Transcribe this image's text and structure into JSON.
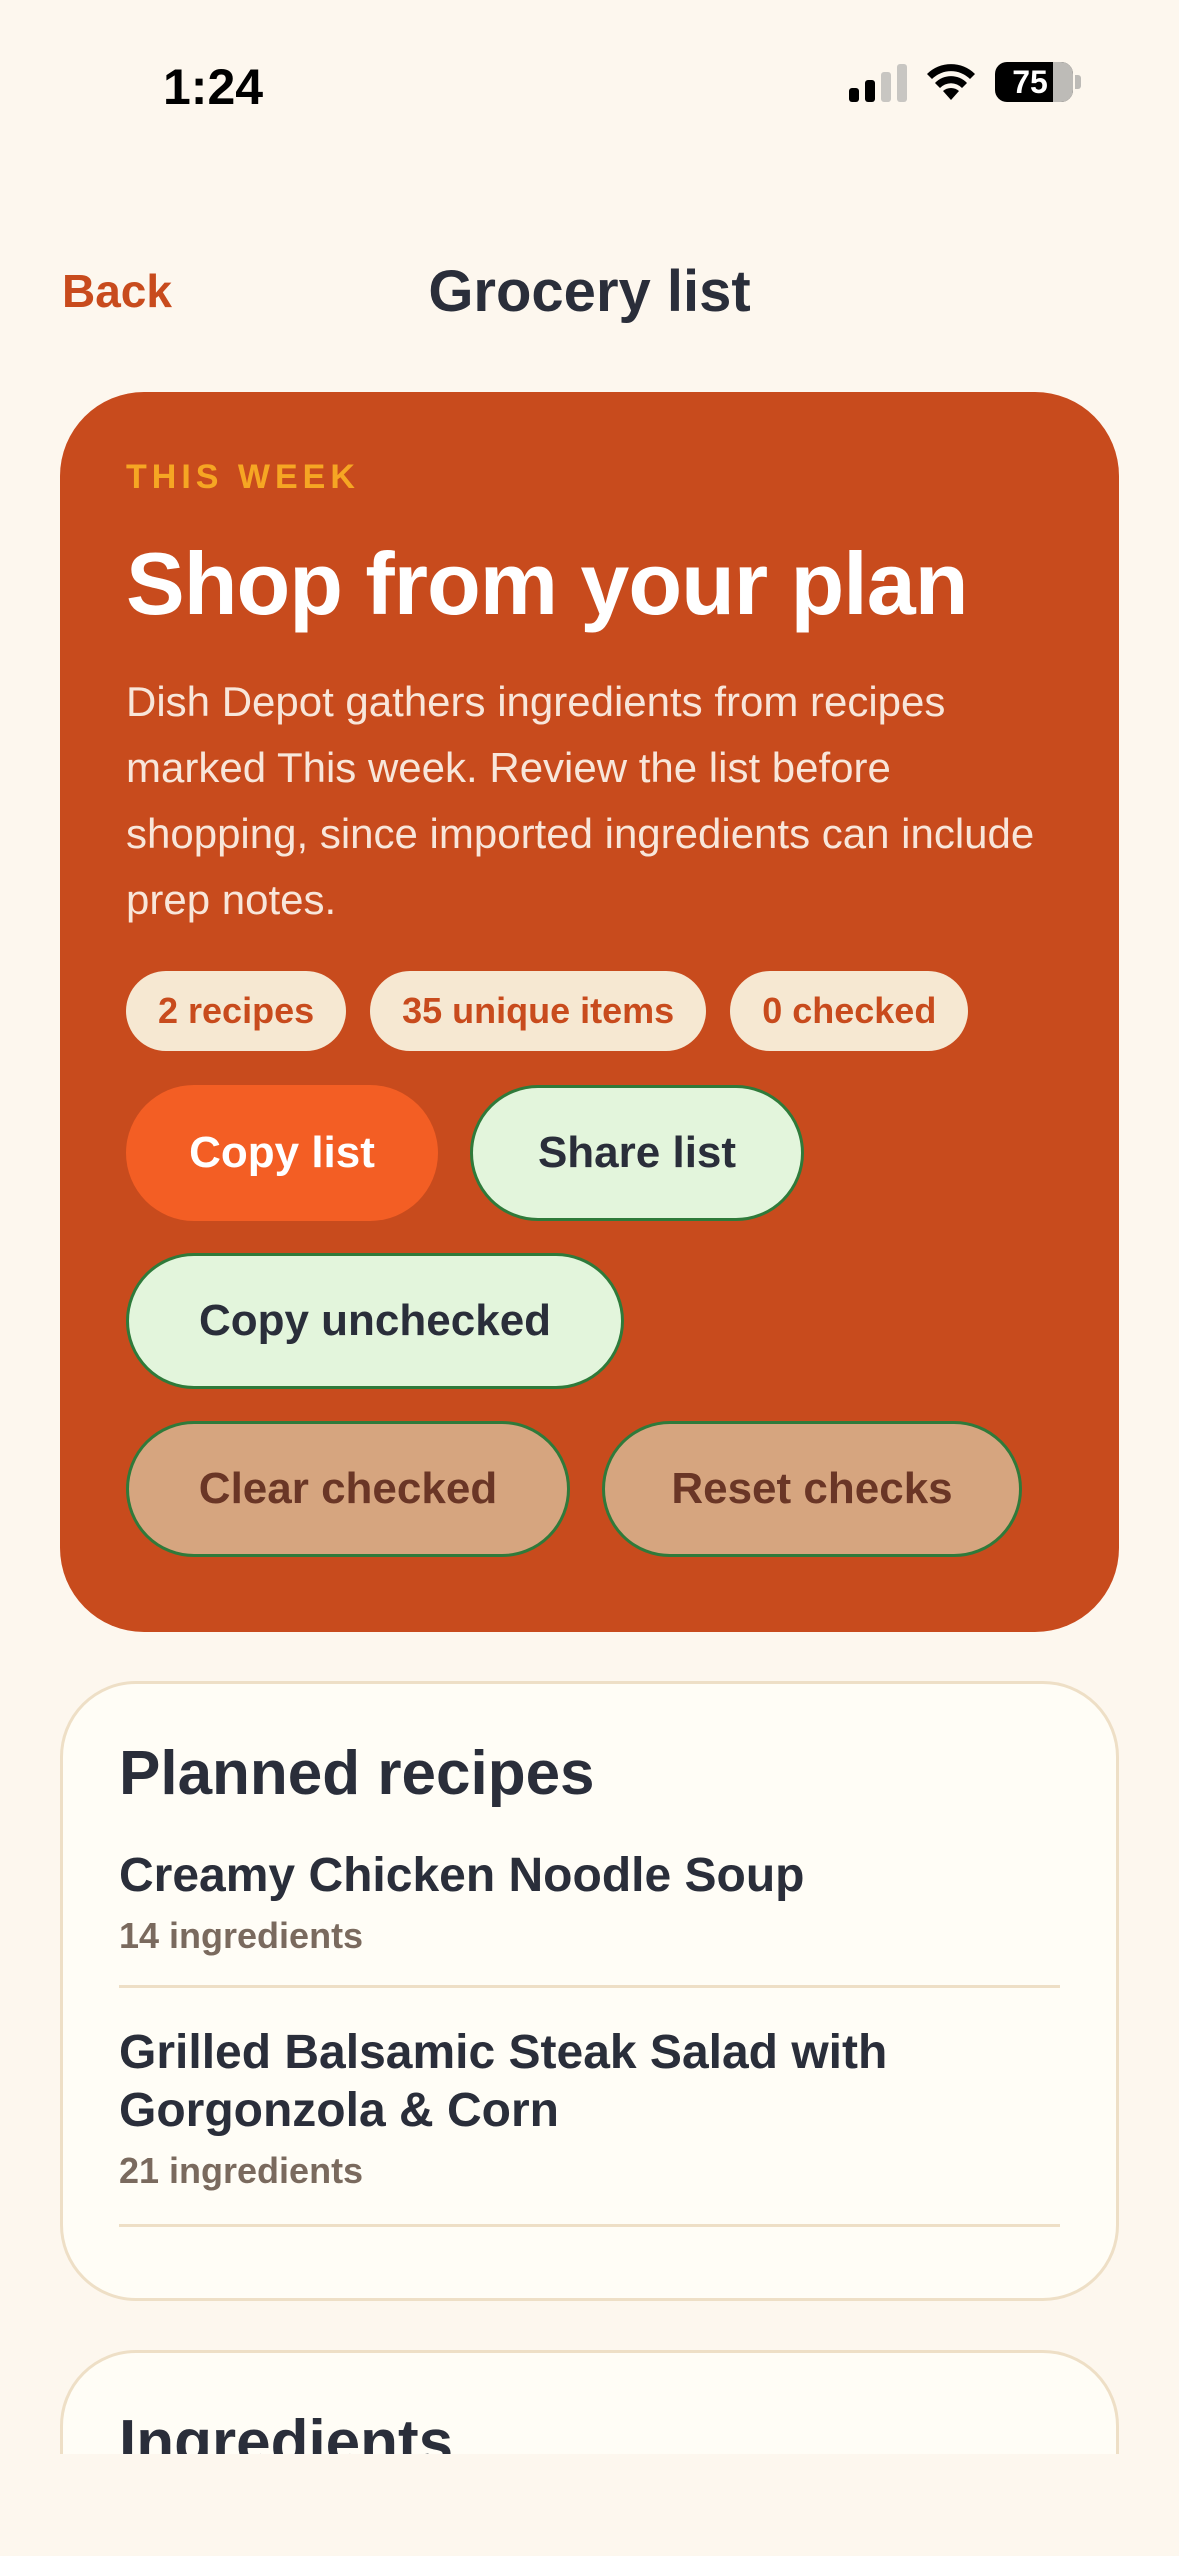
{
  "status_bar": {
    "time": "1:24",
    "battery": "75"
  },
  "nav": {
    "back_label": "Back",
    "title": "Grocery list"
  },
  "hero": {
    "eyebrow": "THIS WEEK",
    "title": "Shop from your plan",
    "description": "Dish Depot gathers ingredients from recipes marked This week. Review the list before shopping, since imported ingredients can include prep notes.",
    "chips": [
      "2 recipes",
      "35 unique items",
      "0 checked"
    ],
    "buttons": {
      "copy_list": "Copy list",
      "share_list": "Share list",
      "copy_unchecked": "Copy unchecked",
      "clear_checked": "Clear checked",
      "reset_checks": "Reset checks"
    }
  },
  "planned_recipes": {
    "title": "Planned recipes",
    "items": [
      {
        "name": "Creamy Chicken Noodle Soup",
        "meta": "14 ingredients"
      },
      {
        "name": "Grilled Balsamic Steak Salad with Gorgonzola & Corn",
        "meta": "21 ingredients"
      }
    ]
  },
  "ingredients": {
    "title": "Ingredients"
  },
  "colors": {
    "background": "#FDF7EE",
    "hero": "#C84B1D",
    "accent": "#F35E24",
    "eyebrow": "#F6A623",
    "green_button": "#E3F5DC",
    "tan_button": "#D6A57F"
  },
  "icons": [
    "signal-icon",
    "wifi-icon",
    "battery-icon"
  ]
}
